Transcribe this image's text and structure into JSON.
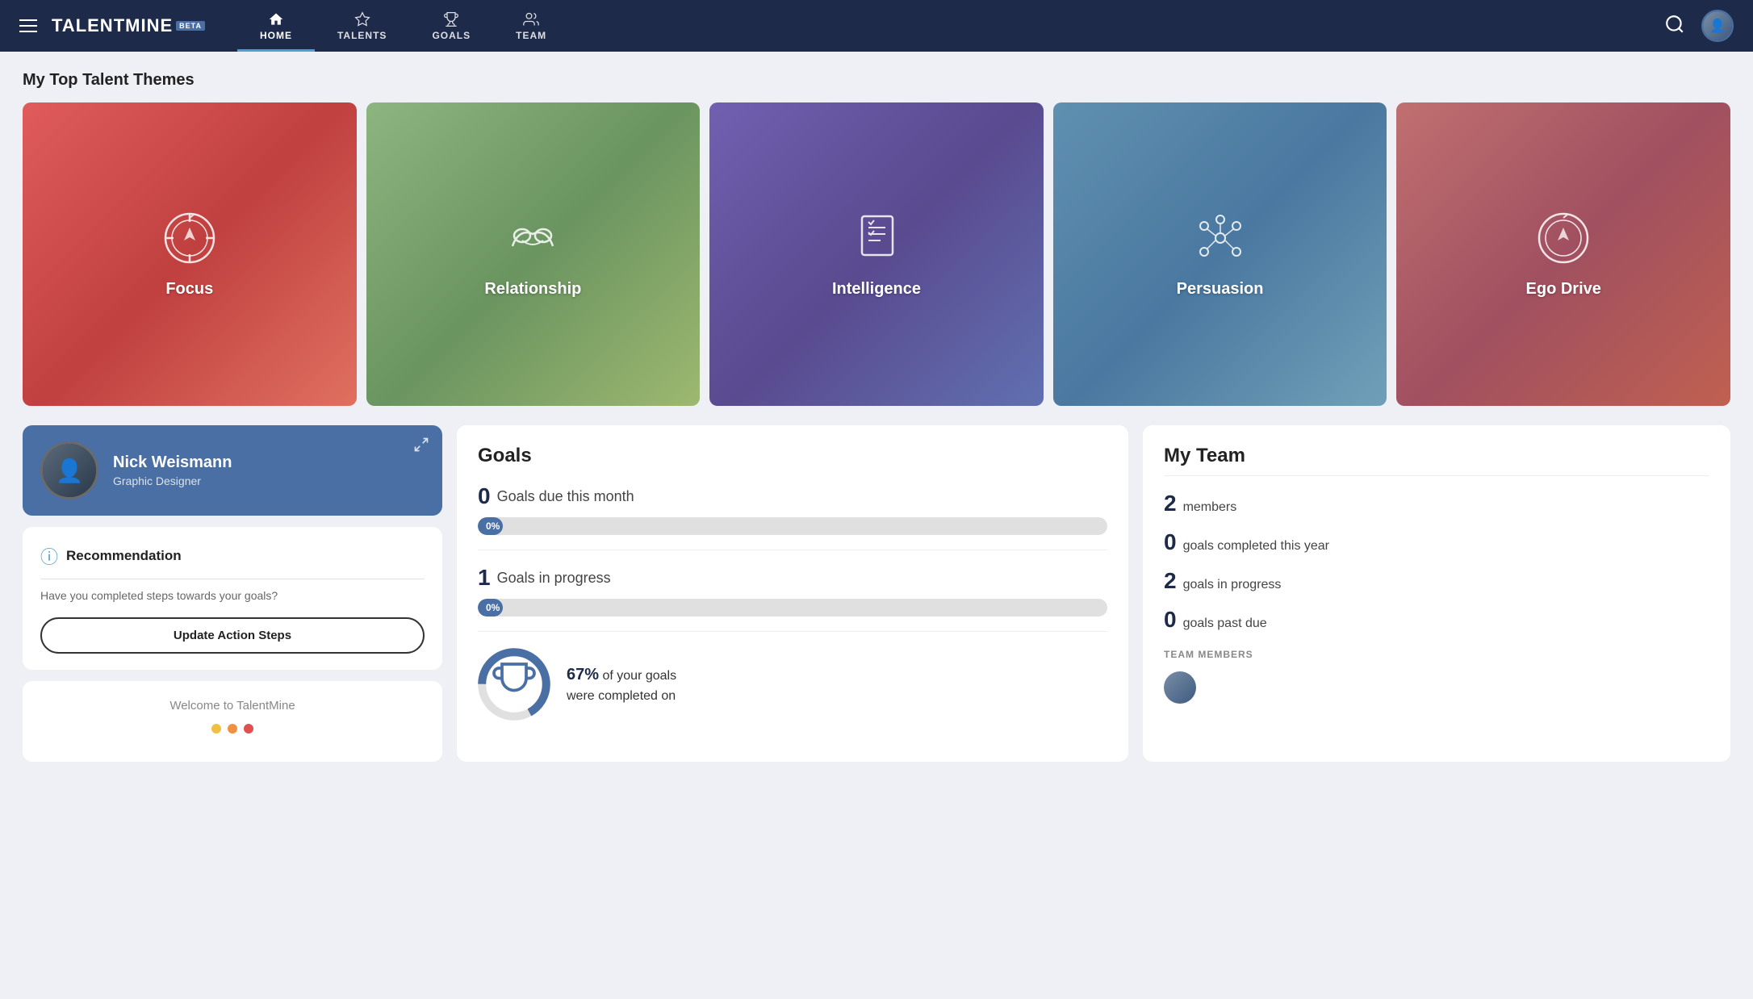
{
  "app": {
    "name": "TALENTMINE",
    "badge": "BETA"
  },
  "navbar": {
    "links": [
      {
        "id": "home",
        "label": "HOME",
        "active": true
      },
      {
        "id": "talents",
        "label": "TALENTS",
        "active": false
      },
      {
        "id": "goals",
        "label": "GOALS",
        "active": false
      },
      {
        "id": "team",
        "label": "TEAM",
        "active": false
      }
    ]
  },
  "top_talents": {
    "section_title": "My Top Talent Themes",
    "themes": [
      {
        "id": "focus",
        "label": "Focus",
        "icon": "⏱"
      },
      {
        "id": "relationship",
        "label": "Relationship",
        "icon": "🤝"
      },
      {
        "id": "intelligence",
        "label": "Intelligence",
        "icon": "📋"
      },
      {
        "id": "persuasion",
        "label": "Persuasion",
        "icon": "🔗"
      },
      {
        "id": "egodrive",
        "label": "Ego Drive",
        "icon": "⏱"
      }
    ]
  },
  "profile": {
    "name": "Nick Weismann",
    "title": "Graphic Designer"
  },
  "recommendation": {
    "title": "Recommendation",
    "body": "Have you completed steps towards your goals?",
    "button_label": "Update Action Steps"
  },
  "welcome": {
    "title": "Welcome to TalentMine",
    "dots": [
      {
        "color": "#f0c040"
      },
      {
        "color": "#f09040"
      },
      {
        "color": "#e05050"
      }
    ]
  },
  "goals": {
    "section_title": "Goals",
    "due_this_month": {
      "count": 0,
      "label": "Goals due this month",
      "progress": 0,
      "progress_label": "0%"
    },
    "in_progress": {
      "count": 1,
      "label": "Goals in progress",
      "progress": 0,
      "progress_label": "0%"
    },
    "completed_percent": "67%",
    "completed_text": "of your goals were completed on"
  },
  "my_team": {
    "section_title": "My Team",
    "stats": [
      {
        "num": "2",
        "label": "members"
      },
      {
        "num": "0",
        "label": "goals completed this year"
      },
      {
        "num": "2",
        "label": "goals in progress"
      },
      {
        "num": "0",
        "label": "goals past due"
      }
    ],
    "members_label": "TEAM MEMBERS"
  }
}
